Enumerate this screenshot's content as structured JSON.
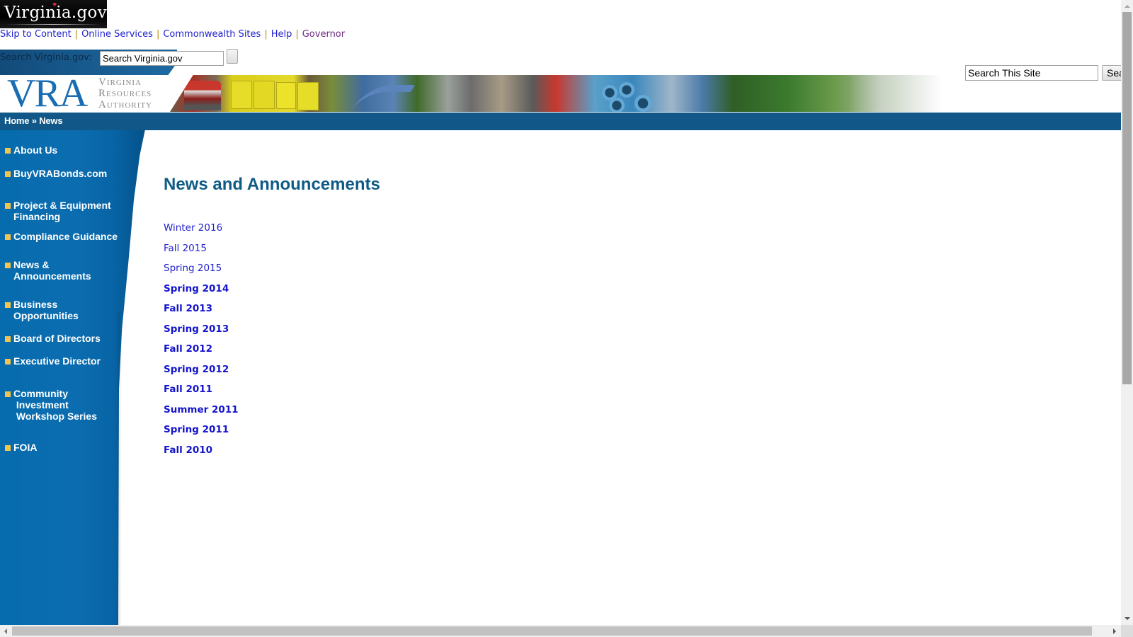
{
  "portal": {
    "logo_text": "Virginia.gov",
    "links": [
      {
        "label": "Skip to Content",
        "visited": false
      },
      {
        "label": "Online Services",
        "visited": false
      },
      {
        "label": "Commonwealth Sites",
        "visited": false
      },
      {
        "label": "Help",
        "visited": false
      },
      {
        "label": "Governor",
        "visited": true
      }
    ],
    "search_label": "Search Virginia.gov:",
    "search_value": "Search Virginia.gov",
    "search_button_label": ""
  },
  "header": {
    "logo_letters": "VRA",
    "org_name_lines": [
      "Virginia",
      "Resources",
      "Authority"
    ],
    "site_search_value": "Search This Site",
    "site_search_button_label": "Search"
  },
  "breadcrumb": {
    "items": [
      "Home",
      "News"
    ],
    "separator": "»"
  },
  "sidebar": {
    "items": [
      {
        "label": "About Us"
      },
      {
        "label": "BuyVRABonds.com"
      },
      {
        "label": "Project & Equipment\nFinancing"
      },
      {
        "label": "Compliance Guidance"
      },
      {
        "label": "News &\nAnnouncements"
      },
      {
        "label": "Business\nOpportunities"
      },
      {
        "label": "Board of Directors"
      },
      {
        "label": "Executive Director"
      },
      {
        "label": "Community\n Investment\n Workshop Series"
      },
      {
        "label": "FOIA"
      }
    ]
  },
  "main": {
    "title": "News and Announcements",
    "newsletters": [
      {
        "label": "Winter 2016",
        "style": "recent"
      },
      {
        "label": "Fall 2015",
        "style": "recent"
      },
      {
        "label": "Spring 2015",
        "style": "recent"
      },
      {
        "label": "Spring 2014",
        "style": "old"
      },
      {
        "label": "Fall 2013",
        "style": "old"
      },
      {
        "label": "Spring 2013",
        "style": "old"
      },
      {
        "label": "Fall 2012",
        "style": "old"
      },
      {
        "label": "Spring 2012",
        "style": "old"
      },
      {
        "label": "Fall 2011",
        "style": "old"
      },
      {
        "label": "Summer 2011",
        "style": "old"
      },
      {
        "label": "Spring 2011",
        "style": "old"
      },
      {
        "label": "Fall 2010",
        "style": "old"
      }
    ]
  },
  "colors": {
    "brand_blue": "#115788",
    "sidebar_blue": "#0b6db0",
    "bullet_gold": "#f1c44f",
    "title_blue": "#0e5a87",
    "link_blue": "#2222cc",
    "visited_purple": "#6b2c7e"
  }
}
